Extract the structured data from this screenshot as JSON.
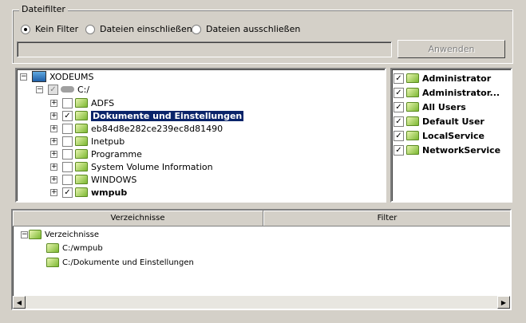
{
  "filter": {
    "title": "Dateifilter",
    "options": [
      {
        "label": "Kein Filter",
        "selected": true
      },
      {
        "label": "Dateien einschließen",
        "selected": false
      },
      {
        "label": "Dateien ausschließen",
        "selected": false
      }
    ],
    "pattern_value": "",
    "apply_label": "Anwenden"
  },
  "tree": {
    "root": "XODEUMS",
    "drive": "C:/",
    "children": [
      {
        "label": "ADFS",
        "checked": false,
        "style": ""
      },
      {
        "label": "Dokumente und Einstellungen",
        "checked": true,
        "style": "sel"
      },
      {
        "label": "eb84d8e282ce239ec8d81490",
        "checked": false,
        "style": ""
      },
      {
        "label": "Inetpub",
        "checked": false,
        "style": ""
      },
      {
        "label": "Programme",
        "checked": false,
        "style": ""
      },
      {
        "label": "System Volume Information",
        "checked": false,
        "style": ""
      },
      {
        "label": "WINDOWS",
        "checked": false,
        "style": ""
      },
      {
        "label": "wmpub",
        "checked": true,
        "style": "bold"
      }
    ]
  },
  "subfolders": [
    {
      "label": "Administrator",
      "checked": true
    },
    {
      "label": "Administrator...",
      "checked": true
    },
    {
      "label": "All Users",
      "checked": true
    },
    {
      "label": "Default User",
      "checked": true
    },
    {
      "label": "LocalService",
      "checked": true
    },
    {
      "label": "NetworkService",
      "checked": true
    }
  ],
  "list": {
    "columns": [
      "Verzeichnisse",
      "Filter"
    ],
    "root": "Verzeichnisse",
    "items": [
      "C:/wmpub",
      "C:/Dokumente und Einstellungen"
    ]
  }
}
